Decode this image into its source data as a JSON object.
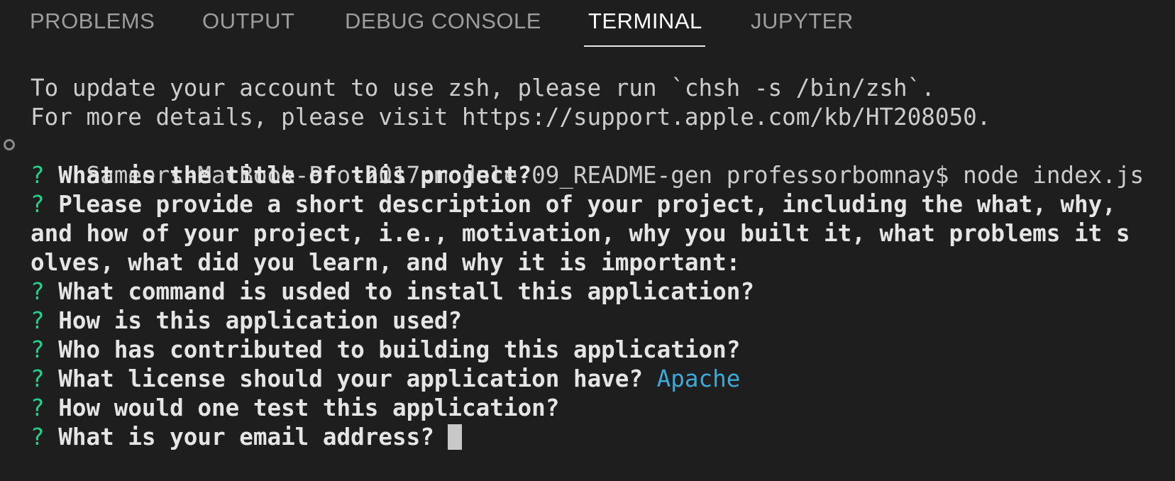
{
  "tabs": [
    {
      "label": "PROBLEMS"
    },
    {
      "label": "OUTPUT"
    },
    {
      "label": "DEBUG CONSOLE"
    },
    {
      "label": "TERMINAL",
      "active": true
    },
    {
      "label": "JUPYTER"
    }
  ],
  "terminal": {
    "info_lines": [
      "To update your account to use zsh, please run `chsh -s /bin/zsh`.",
      "For more details, please visit https://support.apple.com/kb/HT208050."
    ],
    "prompt": "Sameers-MacBook-Pro-2017:module-09_README-gen professorbomnay$ node index.js",
    "question_mark": "?",
    "questions": [
      {
        "text": "What is the title of this project?"
      },
      {
        "text": "Please provide a short description of your project, including the what, why,",
        "continuation": [
          "and how of your project, i.e., motivation, why you built it, what problems it s",
          "olves, what did you learn, and why it is important:"
        ]
      },
      {
        "text": "What command is usded to install this application?"
      },
      {
        "text": "How is this application used?"
      },
      {
        "text": "Who has contributed to building this application?"
      },
      {
        "text": "What license should your application have?",
        "answer": "Apache"
      },
      {
        "text": "How would one test this application?"
      },
      {
        "text": "What is your email address?"
      }
    ]
  },
  "colors": {
    "background": "#1e1e1e",
    "question_mark": "#23d18b",
    "answer": "#3ea8d8",
    "active_tab": "#ffffff",
    "inactive_tab": "#9d9d9d"
  }
}
